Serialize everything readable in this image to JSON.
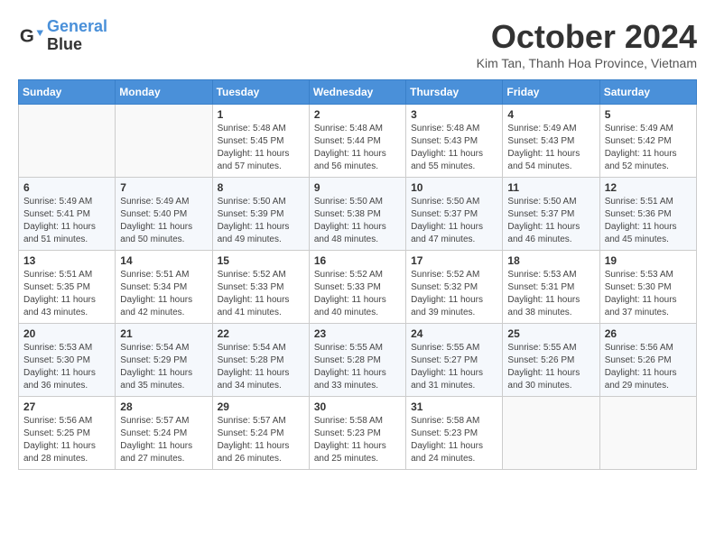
{
  "logo": {
    "line1": "General",
    "line2": "Blue"
  },
  "header": {
    "month": "October 2024",
    "location": "Kim Tan, Thanh Hoa Province, Vietnam"
  },
  "weekdays": [
    "Sunday",
    "Monday",
    "Tuesday",
    "Wednesday",
    "Thursday",
    "Friday",
    "Saturday"
  ],
  "weeks": [
    [
      {
        "day": "",
        "info": ""
      },
      {
        "day": "",
        "info": ""
      },
      {
        "day": "1",
        "info": "Sunrise: 5:48 AM\nSunset: 5:45 PM\nDaylight: 11 hours\nand 57 minutes."
      },
      {
        "day": "2",
        "info": "Sunrise: 5:48 AM\nSunset: 5:44 PM\nDaylight: 11 hours\nand 56 minutes."
      },
      {
        "day": "3",
        "info": "Sunrise: 5:48 AM\nSunset: 5:43 PM\nDaylight: 11 hours\nand 55 minutes."
      },
      {
        "day": "4",
        "info": "Sunrise: 5:49 AM\nSunset: 5:43 PM\nDaylight: 11 hours\nand 54 minutes."
      },
      {
        "day": "5",
        "info": "Sunrise: 5:49 AM\nSunset: 5:42 PM\nDaylight: 11 hours\nand 52 minutes."
      }
    ],
    [
      {
        "day": "6",
        "info": "Sunrise: 5:49 AM\nSunset: 5:41 PM\nDaylight: 11 hours\nand 51 minutes."
      },
      {
        "day": "7",
        "info": "Sunrise: 5:49 AM\nSunset: 5:40 PM\nDaylight: 11 hours\nand 50 minutes."
      },
      {
        "day": "8",
        "info": "Sunrise: 5:50 AM\nSunset: 5:39 PM\nDaylight: 11 hours\nand 49 minutes."
      },
      {
        "day": "9",
        "info": "Sunrise: 5:50 AM\nSunset: 5:38 PM\nDaylight: 11 hours\nand 48 minutes."
      },
      {
        "day": "10",
        "info": "Sunrise: 5:50 AM\nSunset: 5:37 PM\nDaylight: 11 hours\nand 47 minutes."
      },
      {
        "day": "11",
        "info": "Sunrise: 5:50 AM\nSunset: 5:37 PM\nDaylight: 11 hours\nand 46 minutes."
      },
      {
        "day": "12",
        "info": "Sunrise: 5:51 AM\nSunset: 5:36 PM\nDaylight: 11 hours\nand 45 minutes."
      }
    ],
    [
      {
        "day": "13",
        "info": "Sunrise: 5:51 AM\nSunset: 5:35 PM\nDaylight: 11 hours\nand 43 minutes."
      },
      {
        "day": "14",
        "info": "Sunrise: 5:51 AM\nSunset: 5:34 PM\nDaylight: 11 hours\nand 42 minutes."
      },
      {
        "day": "15",
        "info": "Sunrise: 5:52 AM\nSunset: 5:33 PM\nDaylight: 11 hours\nand 41 minutes."
      },
      {
        "day": "16",
        "info": "Sunrise: 5:52 AM\nSunset: 5:33 PM\nDaylight: 11 hours\nand 40 minutes."
      },
      {
        "day": "17",
        "info": "Sunrise: 5:52 AM\nSunset: 5:32 PM\nDaylight: 11 hours\nand 39 minutes."
      },
      {
        "day": "18",
        "info": "Sunrise: 5:53 AM\nSunset: 5:31 PM\nDaylight: 11 hours\nand 38 minutes."
      },
      {
        "day": "19",
        "info": "Sunrise: 5:53 AM\nSunset: 5:30 PM\nDaylight: 11 hours\nand 37 minutes."
      }
    ],
    [
      {
        "day": "20",
        "info": "Sunrise: 5:53 AM\nSunset: 5:30 PM\nDaylight: 11 hours\nand 36 minutes."
      },
      {
        "day": "21",
        "info": "Sunrise: 5:54 AM\nSunset: 5:29 PM\nDaylight: 11 hours\nand 35 minutes."
      },
      {
        "day": "22",
        "info": "Sunrise: 5:54 AM\nSunset: 5:28 PM\nDaylight: 11 hours\nand 34 minutes."
      },
      {
        "day": "23",
        "info": "Sunrise: 5:55 AM\nSunset: 5:28 PM\nDaylight: 11 hours\nand 33 minutes."
      },
      {
        "day": "24",
        "info": "Sunrise: 5:55 AM\nSunset: 5:27 PM\nDaylight: 11 hours\nand 31 minutes."
      },
      {
        "day": "25",
        "info": "Sunrise: 5:55 AM\nSunset: 5:26 PM\nDaylight: 11 hours\nand 30 minutes."
      },
      {
        "day": "26",
        "info": "Sunrise: 5:56 AM\nSunset: 5:26 PM\nDaylight: 11 hours\nand 29 minutes."
      }
    ],
    [
      {
        "day": "27",
        "info": "Sunrise: 5:56 AM\nSunset: 5:25 PM\nDaylight: 11 hours\nand 28 minutes."
      },
      {
        "day": "28",
        "info": "Sunrise: 5:57 AM\nSunset: 5:24 PM\nDaylight: 11 hours\nand 27 minutes."
      },
      {
        "day": "29",
        "info": "Sunrise: 5:57 AM\nSunset: 5:24 PM\nDaylight: 11 hours\nand 26 minutes."
      },
      {
        "day": "30",
        "info": "Sunrise: 5:58 AM\nSunset: 5:23 PM\nDaylight: 11 hours\nand 25 minutes."
      },
      {
        "day": "31",
        "info": "Sunrise: 5:58 AM\nSunset: 5:23 PM\nDaylight: 11 hours\nand 24 minutes."
      },
      {
        "day": "",
        "info": ""
      },
      {
        "day": "",
        "info": ""
      }
    ]
  ]
}
